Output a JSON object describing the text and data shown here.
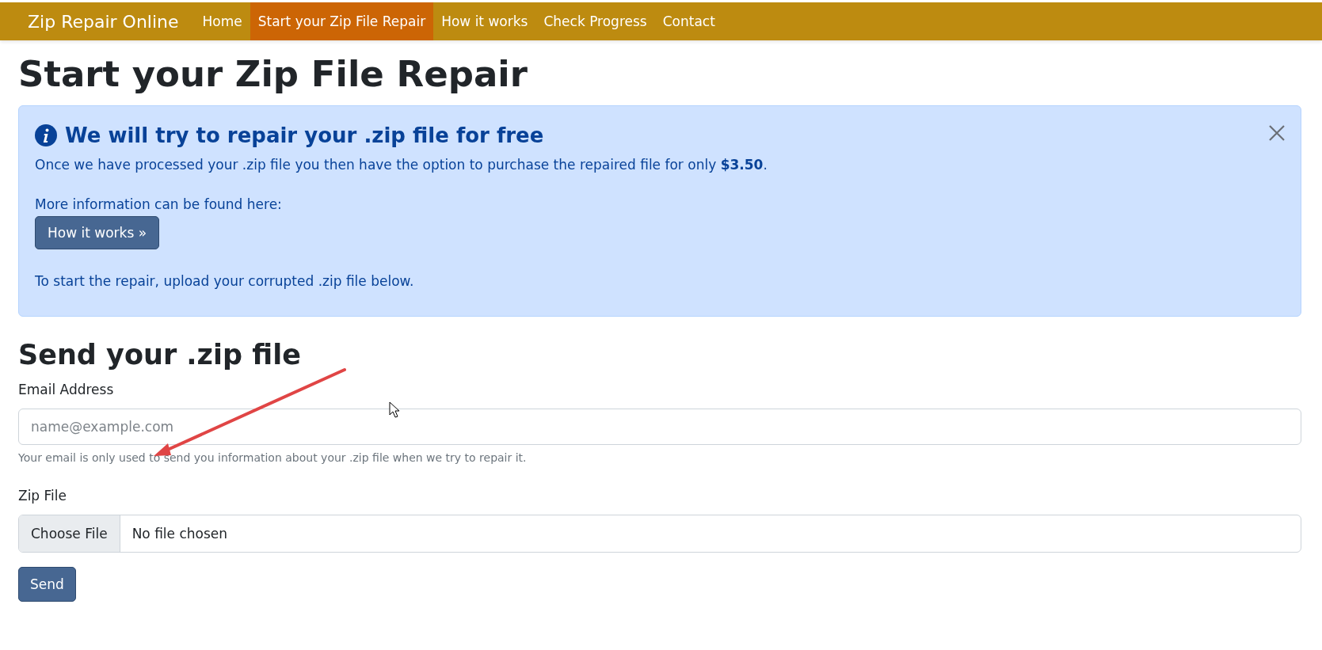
{
  "navbar": {
    "brand": "Zip Repair Online",
    "links": [
      {
        "label": "Home",
        "selected": false
      },
      {
        "label": "Start your Zip File Repair",
        "selected": true
      },
      {
        "label": "How it works",
        "selected": false
      },
      {
        "label": "Check Progress",
        "selected": false
      },
      {
        "label": "Contact",
        "selected": false
      }
    ]
  },
  "page_title": "Start your Zip File Repair",
  "alert": {
    "heading": "We will try to repair your .zip file for free",
    "text": "Once we have processed your .zip file you then have the option to purchase the repaired file for only **$3.50**.",
    "more_info": "More information can be found here:",
    "button": "How it works »",
    "footer": "To start the repair, upload your corrupted .zip file below."
  },
  "form": {
    "title": "Send your .zip file",
    "email": {
      "label": "Email Address",
      "placeholder": "name@example.com",
      "help": "Your email is only used to send you information about your .zip file when we try to repair it."
    },
    "file": {
      "label": "Zip File",
      "button": "Choose File",
      "status": "No file chosen"
    },
    "submit": "Send"
  }
}
